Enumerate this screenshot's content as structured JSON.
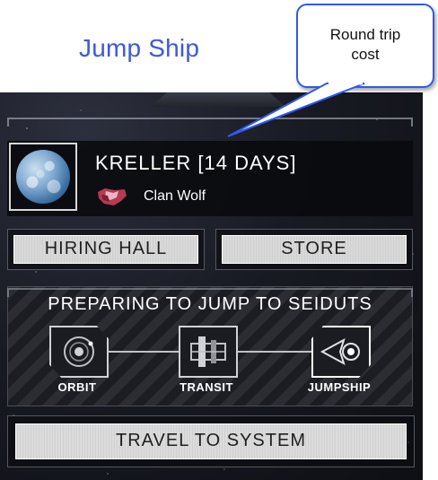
{
  "annotation": {
    "heading": "Jump Ship",
    "callout": "Round trip cost"
  },
  "system": {
    "name": "KRELLER [14 DAYS]",
    "faction": "Clan Wolf"
  },
  "buttons": {
    "hiring_hall": "HIRING HALL",
    "store": "STORE",
    "travel": "TRAVEL TO SYSTEM"
  },
  "jump": {
    "title": "PREPARING TO JUMP TO SEIDUTS",
    "steps": [
      {
        "label": "ORBIT",
        "icon": "orbit-icon"
      },
      {
        "label": "TRANSIT",
        "icon": "transit-icon"
      },
      {
        "label": "JUMPSHIP",
        "icon": "jumpship-icon",
        "active": true
      }
    ]
  },
  "colors": {
    "annotation_blue": "#2f5aeb",
    "heading_blue": "#3f5bd6",
    "panel_bg": "#191b24",
    "button_face": "#d9d9d9"
  }
}
